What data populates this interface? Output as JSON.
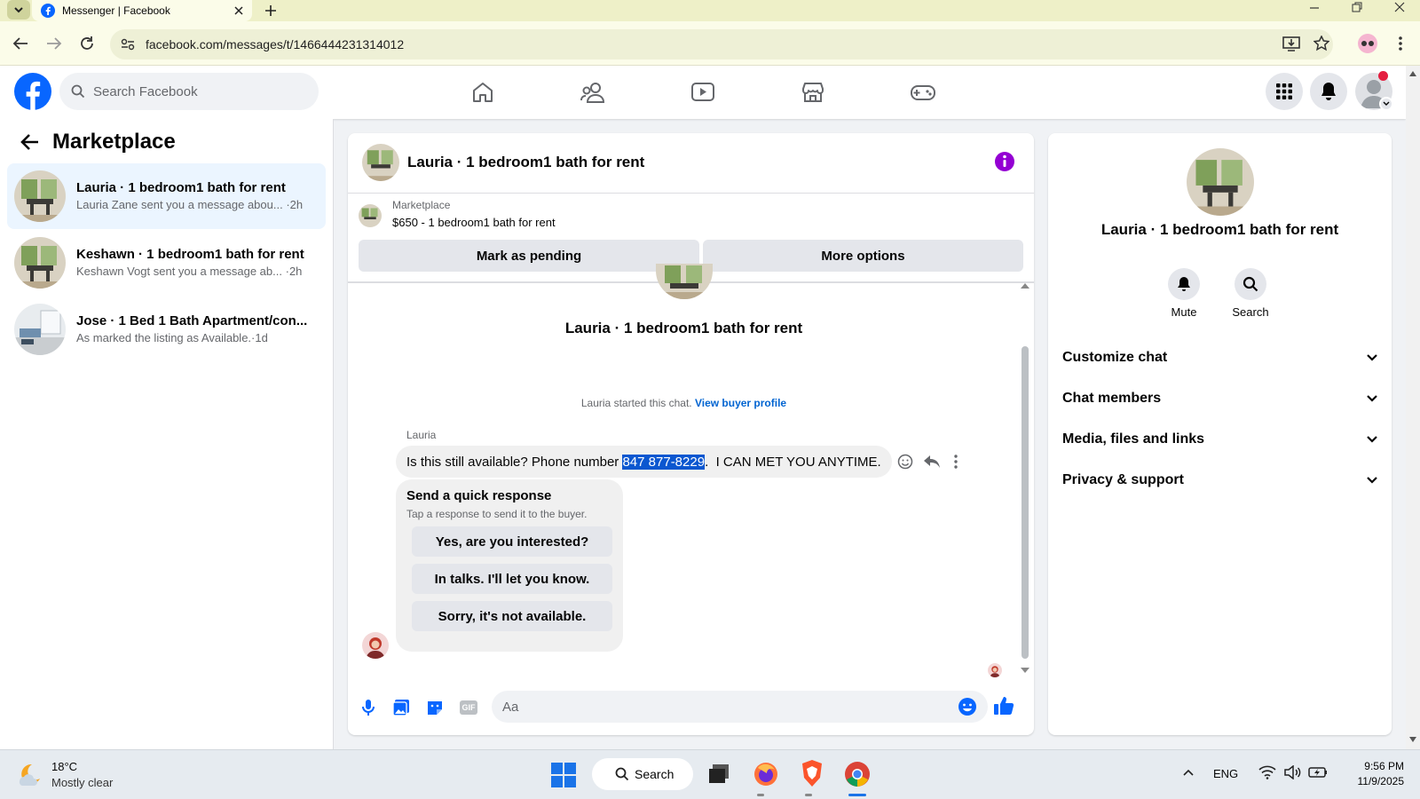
{
  "browser": {
    "tab_title": "Messenger | Facebook",
    "url": "facebook.com/messages/t/1466444231314012"
  },
  "topbar": {
    "search_placeholder": "Search Facebook",
    "brand_color": "#0866ff"
  },
  "sidebar": {
    "title": "Marketplace",
    "conversations": [
      {
        "title": "Lauria · 1 bedroom1 bath for rent",
        "preview": "Lauria Zane sent you a message abou...",
        "time": "·2h",
        "selected": true
      },
      {
        "title": "Keshawn · 1 bedroom1 bath for rent",
        "preview": "Keshawn Vogt sent you a message ab...",
        "time": "·2h",
        "selected": false
      },
      {
        "title": "Jose · 1 Bed 1 Bath Apartment/con...",
        "preview": "As marked the listing as Available.",
        "time": "·1d",
        "selected": false
      }
    ]
  },
  "chat": {
    "header_title": "Lauria · 1 bedroom1 bath for rent",
    "listing_source": "Marketplace",
    "listing_price_title": "$650 - 1 bedroom1 bath for rent",
    "mark_pending_label": "Mark as pending",
    "more_options_label": "More options",
    "intro_title": "Lauria · 1 bedroom1 bath for rent",
    "started_text": "Lauria started this chat.",
    "view_profile_link": "View buyer profile",
    "sender_name": "Lauria",
    "message_before": "Is this still available? Phone number ",
    "message_highlight": "847 877-8229",
    "message_after": ".  I CAN MET YOU ANYTIME.",
    "quick_title": "Send a quick response",
    "quick_subtitle": "Tap a response to send it to the buyer.",
    "quick_responses": [
      "Yes, are you interested?",
      "In talks. I'll let you know.",
      "Sorry, it's not available."
    ],
    "composer_placeholder": "Aa"
  },
  "details": {
    "title": "Lauria · 1 bedroom1 bath for rent",
    "mute_label": "Mute",
    "search_label": "Search",
    "sections": [
      "Customize chat",
      "Chat members",
      "Media, files and links",
      "Privacy & support"
    ]
  },
  "taskbar": {
    "temperature": "18°C",
    "weather": "Mostly clear",
    "search_label": "Search",
    "language": "ENG",
    "time": "9:56 PM",
    "date": "11/9/2025"
  }
}
